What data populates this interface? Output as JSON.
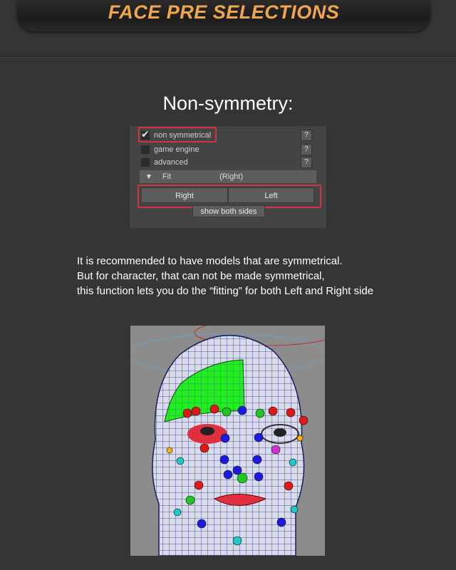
{
  "header": {
    "title": "FACE PRE SELECTIONS"
  },
  "section": {
    "heading": "Non-symmetry:"
  },
  "panel": {
    "options": [
      {
        "label": "non symmetrical",
        "checked": true,
        "help": "?"
      },
      {
        "label": "game engine",
        "checked": false,
        "help": "?"
      },
      {
        "label": "advanced",
        "checked": false,
        "help": "?"
      }
    ],
    "fit": {
      "label": "Fit",
      "value": "(Right)"
    },
    "buttons": {
      "right": "Right",
      "left": "Left",
      "both": "show both sides"
    }
  },
  "description": {
    "lines": [
      "It is recommended to have models that are symmetrical.",
      "But for character, that can not be made symmetrical,",
      "this function lets you do the “fitting” for both Left and Right side"
    ]
  },
  "colors": {
    "accent": "#f0a64a",
    "highlight": "#d0353d",
    "selection": "#22ee22",
    "wire": "#2a2a8a"
  }
}
